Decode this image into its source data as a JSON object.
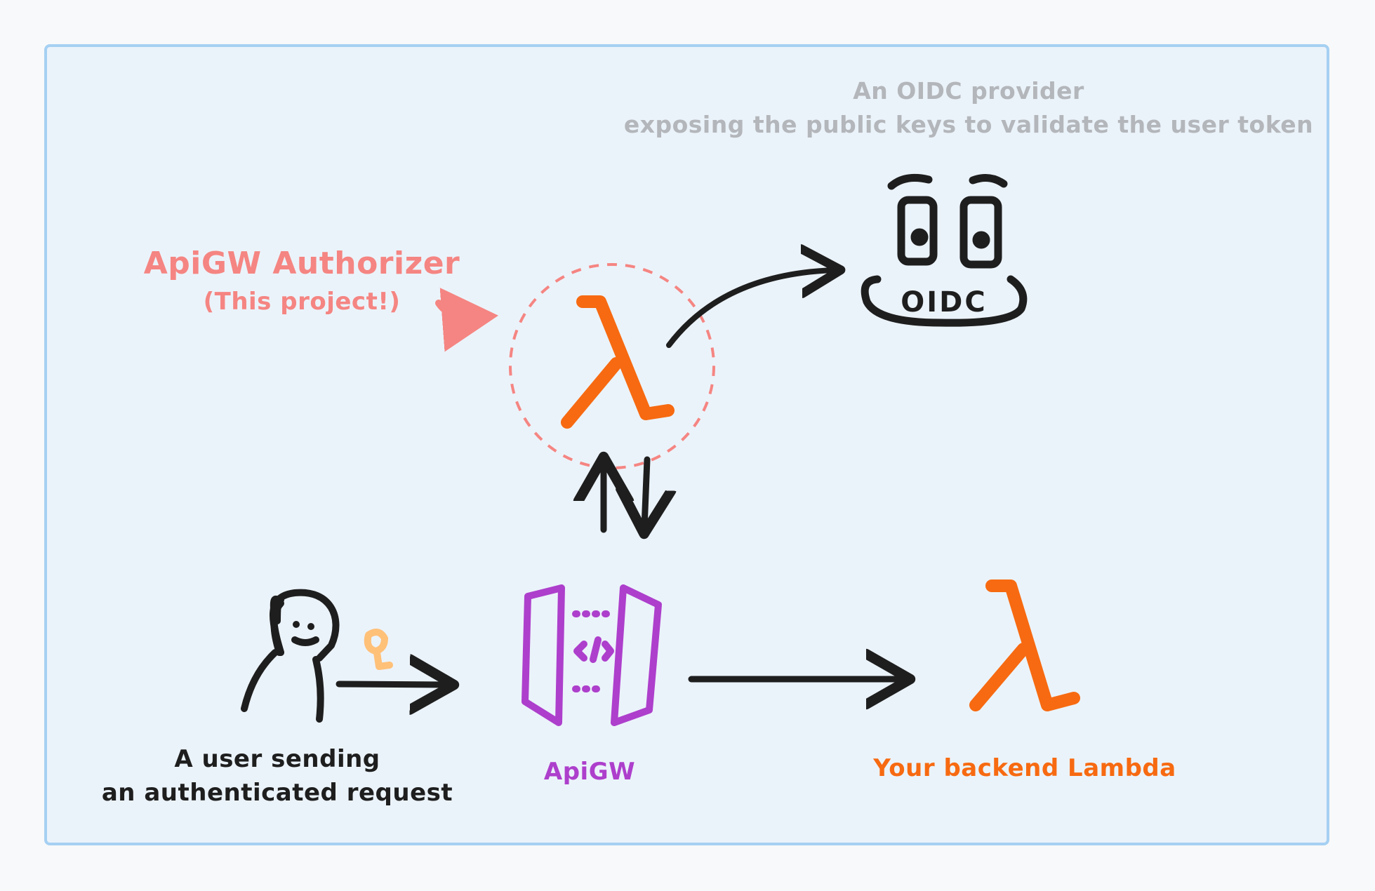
{
  "labels": {
    "oidc_caption_line1": "An OIDC provider",
    "oidc_caption_line2": "exposing the public keys to validate the user token",
    "authorizer_title": "ApiGW Authorizer",
    "authorizer_subtitle": "(This project!)",
    "user_caption_line1": "A user sending",
    "user_caption_line2": "an authenticated request",
    "apigw_caption": "ApiGW",
    "backend_caption": "Your backend Lambda",
    "oidc_badge": "OIDC",
    "lambda_symbol": "λ"
  },
  "colors": {
    "background": "#f8f9fa",
    "frame_fill": "#ebf3fa",
    "frame_border": "#a5d0f2",
    "stroke": "#1e1e1e",
    "lambda": "#f76a11",
    "authorizer": "#f58582",
    "apigw": "#ad3fcc",
    "key": "#ffc078",
    "caption_gray": "#b3b6ba"
  },
  "icons": [
    "user-icon",
    "key-icon",
    "apigw-icon",
    "lambda-icon",
    "oidc-provider-icon"
  ]
}
